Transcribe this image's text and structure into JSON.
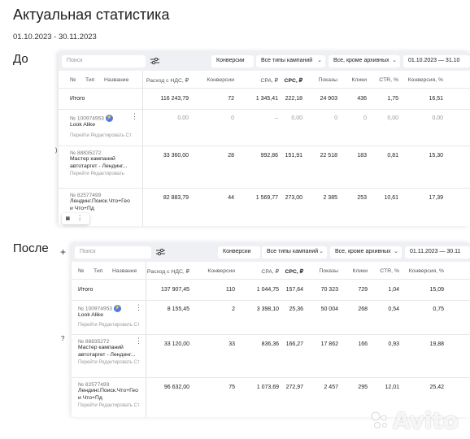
{
  "page": {
    "title": "Актуальная статистика",
    "date_range": "01.10.2023 - 30.11.2023",
    "label_before": "До",
    "label_after": "После",
    "watermark": "Avito"
  },
  "toolbar": {
    "search_placeholder": "Поиск",
    "conversions": "Конверсии",
    "campaign_types": "Все типы кампаний",
    "archive_filter": "Все, кроме архивных"
  },
  "columns": {
    "num": "№",
    "type": "Тип",
    "name": "Название",
    "spend": "Расход с НДС, ₽",
    "conversions": "Конверсии",
    "cpa": "CPA, ₽",
    "cpc": "CPC, ₽",
    "impressions": "Показы",
    "clicks": "Клики",
    "ctr": "CTR, %",
    "conv_rate": "Конверсия, %"
  },
  "before": {
    "period": "01.10.2023 — 31.10",
    "total_label": "Итого",
    "total": {
      "spend": "116 243,79",
      "conversions": "72",
      "cpa": "1 345,41",
      "cpc": "222,18",
      "impressions": "24 903",
      "clicks": "436",
      "ctr": "1,75",
      "conv_rate": "16,51"
    },
    "rows": [
      {
        "id": "№ 100974953",
        "name": "Look Alike",
        "name2": "",
        "links": "Перейти  Редактировать  Ст",
        "spend": "0,00",
        "conversions": "0",
        "cpa": "–",
        "cpc": "0,00",
        "impressions": "0",
        "clicks": "0",
        "ctr": "0,00",
        "conv_rate": "0,00"
      },
      {
        "id": "№ 88835272",
        "name": "Мастер кампаний",
        "name2": "автотаргет - Лендинг...",
        "links": "Перейти  Редактировать",
        "spend": "33 360,00",
        "conversions": "28",
        "cpa": "992,86",
        "cpc": "151,91",
        "impressions": "22 518",
        "clicks": "183",
        "ctr": "0,81",
        "conv_rate": "15,30"
      },
      {
        "id": "№ 82577499",
        "name": "Лендинг.Поиск.Что+Гео",
        "name2": "и Что+Пд",
        "links": "",
        "spend": "82 883,79",
        "conversions": "44",
        "cpa": "1 569,77",
        "cpc": "273,00",
        "impressions": "2 385",
        "clicks": "253",
        "ctr": "10,61",
        "conv_rate": "17,39"
      }
    ]
  },
  "after": {
    "period": "01.11.2023 — 30.11",
    "total_label": "Итого",
    "total": {
      "spend": "137 907,45",
      "conversions": "110",
      "cpa": "1 044,75",
      "cpc": "157,64",
      "impressions": "70 323",
      "clicks": "729",
      "ctr": "1,04",
      "conv_rate": "15,09"
    },
    "rows": [
      {
        "id": "№ 100974953",
        "name": "Look Alike",
        "name2": "",
        "links": "Перейти  Редактировать  Ст",
        "spend": "8 155,45",
        "conversions": "2",
        "cpa": "3 398,10",
        "cpc": "25,36",
        "impressions": "50 004",
        "clicks": "268",
        "ctr": "0,54",
        "conv_rate": "0,75"
      },
      {
        "id": "№ 88835272",
        "name": "Мастер кампаний",
        "name2": "автотаргет - Лендинг...",
        "links": "Перейти  Редактировать  Ст",
        "spend": "33 120,00",
        "conversions": "33",
        "cpa": "836,36",
        "cpc": "166,27",
        "impressions": "17 862",
        "clicks": "166",
        "ctr": "0,93",
        "conv_rate": "19,88"
      },
      {
        "id": "№ 82577499",
        "name": "Лендинг.Поиск.Что+Гео",
        "name2": "и Что+Пд",
        "links": "Перейти  Редактировать  Ст",
        "spend": "96 632,00",
        "conversions": "75",
        "cpa": "1 073,69",
        "cpc": "272,97",
        "impressions": "2 457",
        "clicks": "295",
        "ctr": "12,01",
        "conv_rate": "25,42"
      }
    ]
  }
}
